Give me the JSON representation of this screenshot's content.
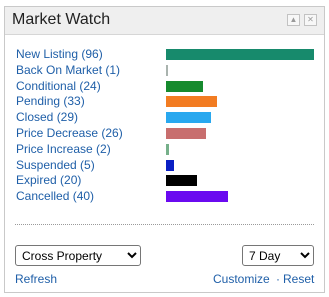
{
  "widget": {
    "title": "Market Watch",
    "minimize_glyph": "▲",
    "close_glyph": "✕"
  },
  "chart_data": {
    "type": "bar",
    "orientation": "horizontal",
    "categories": [
      "New Listing",
      "Back On Market",
      "Conditional",
      "Pending",
      "Closed",
      "Price Decrease",
      "Price Increase",
      "Suspended",
      "Expired",
      "Cancelled"
    ],
    "values": [
      96,
      1,
      24,
      33,
      29,
      26,
      2,
      5,
      20,
      40
    ],
    "labels": [
      "New Listing (96)",
      "Back On Market (1)",
      "Conditional (24)",
      "Pending (33)",
      "Closed (29)",
      "Price Decrease (26)",
      "Price Increase (2)",
      "Suspended (5)",
      "Expired (20)",
      "Cancelled (40)"
    ],
    "colors": [
      "#178a6c",
      "#a9b3ae",
      "#168a2e",
      "#f27c22",
      "#29a8ef",
      "#c86e6e",
      "#76b08a",
      "#0a1fc4",
      "#000000",
      "#6a0af0"
    ],
    "xlim": [
      0,
      96
    ]
  },
  "controls": {
    "property_type": {
      "selected": "Cross Property",
      "options": [
        "Cross Property"
      ]
    },
    "time_range": {
      "selected": "7 Day",
      "options": [
        "7 Day"
      ]
    }
  },
  "links": {
    "refresh": "Refresh",
    "customize": "Customize",
    "separator": "·",
    "reset": "Reset"
  }
}
